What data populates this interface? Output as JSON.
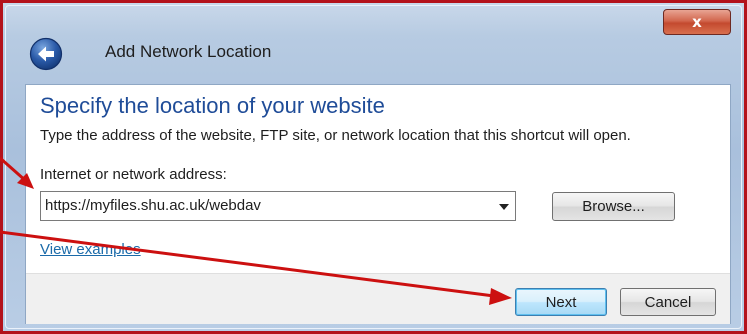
{
  "window": {
    "title": "Add Network Location",
    "close_glyph": "x"
  },
  "page": {
    "heading": "Specify the location of your website",
    "description": "Type the address of the website, FTP site, or network location that this shortcut will open.",
    "field_label": "Internet or network address:",
    "address_value": "https://myfiles.shu.ac.uk/webdav",
    "browse_label": "Browse...",
    "examples_link": "View examples"
  },
  "footer": {
    "next_label": "Next",
    "cancel_label": "Cancel"
  },
  "icons": {
    "back": "back-arrow-icon",
    "close": "close-icon",
    "dropdown": "chevron-down-icon"
  },
  "colors": {
    "annotation_arrow": "#cc1010",
    "heading": "#1f4c98",
    "link": "#1a6aa9",
    "close_button": "#c44a2f"
  }
}
